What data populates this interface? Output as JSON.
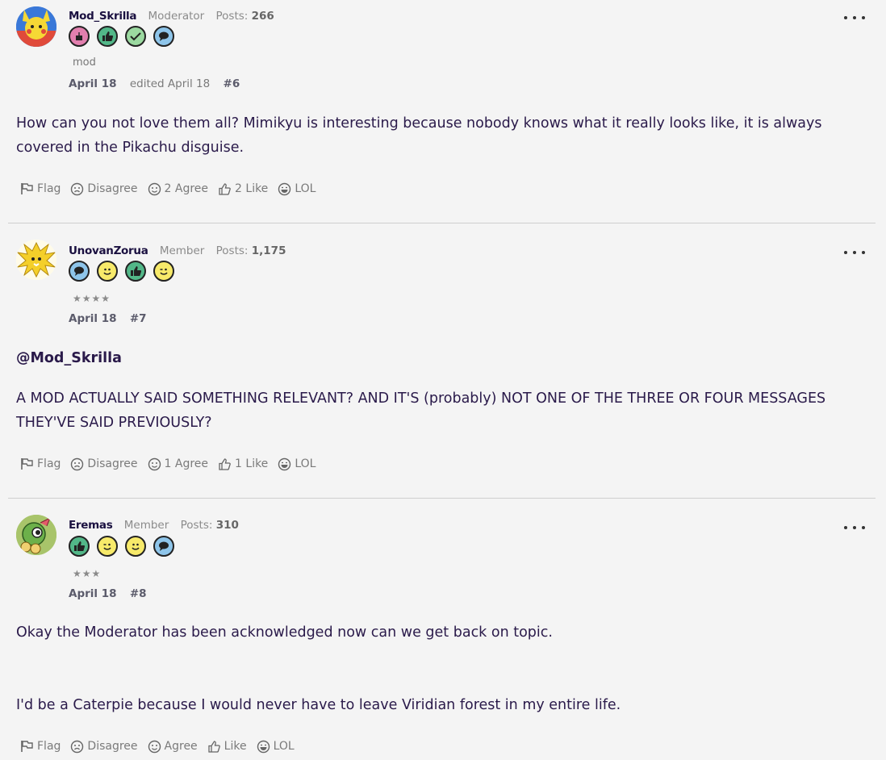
{
  "posts": [
    {
      "username": "Mod_Skrilla",
      "role": "Moderator",
      "posts_label": "Posts:",
      "posts_count": "266",
      "badges": [
        "cake-badge-icon",
        "thumbs-up-badge-icon",
        "checkmark-badge-icon",
        "comment-badge-icon"
      ],
      "title": "mod",
      "date": "April 18",
      "edited": "edited April 18",
      "number": "#6",
      "body": [
        "How can you not love them all? Mimikyu is interesting because nobody knows what it really looks like, it is always covered in the Pikachu disguise."
      ],
      "reactions": {
        "flag": "Flag",
        "disagree": "Disagree",
        "agree": "2 Agree",
        "like": "2 Like",
        "lol": "LOL"
      }
    },
    {
      "username": "UnovanZorua",
      "role": "Member",
      "posts_label": "Posts:",
      "posts_count": "1,175",
      "badges": [
        "comment-badge-icon",
        "smiley-badge-icon",
        "thumbs-up-badge-icon",
        "wink-badge-icon"
      ],
      "title": "★★★★",
      "date": "April 18",
      "number": "#7",
      "mention": "@Mod_Skrilla",
      "body": [
        "A MOD ACTUALLY SAID SOMETHING RELEVANT? AND IT'S (probably) NOT ONE OF THE THREE OR FOUR MESSAGES THEY'VE SAID PREVIOUSLY?"
      ],
      "reactions": {
        "flag": "Flag",
        "disagree": "Disagree",
        "agree": "1 Agree",
        "like": "1 Like",
        "lol": "LOL"
      }
    },
    {
      "username": "Eremas",
      "role": "Member",
      "posts_label": "Posts:",
      "posts_count": "310",
      "badges": [
        "thumbs-up-badge-icon",
        "wink-badge-icon",
        "smiley-badge-icon",
        "comment-badge-icon"
      ],
      "title": "★★★",
      "date": "April 18",
      "number": "#8",
      "body": [
        "Okay the Moderator has been acknowledged now can we get back on topic.",
        "I'd be a Caterpie because I would never have to leave Viridian forest in my entire life."
      ],
      "reactions": {
        "flag": "Flag",
        "disagree": "Disagree",
        "agree": "Agree",
        "like": "Like",
        "lol": "LOL"
      }
    }
  ],
  "colors": {
    "background": "#f4f4f4",
    "text": "#2a1a4a",
    "muted": "#7a7a7a",
    "badge_pink": "#e27fae",
    "badge_green": "#52b788",
    "badge_lightgreen": "#9bd9a0",
    "badge_blue": "#8ec5ea",
    "badge_yellow": "#f7ea6a"
  }
}
